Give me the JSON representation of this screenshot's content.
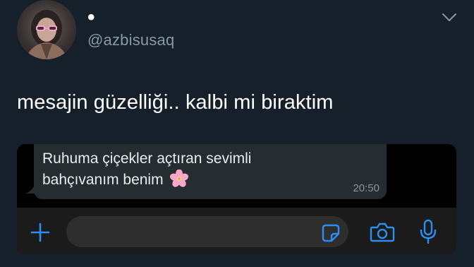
{
  "tweet": {
    "display_name": "•",
    "handle": "@azbisusaq",
    "text": "mesajin güzelliği.. kalbi mi biraktim",
    "menu_icon": "chevron-down-icon"
  },
  "chat": {
    "message": {
      "line1": "Ruhuma çiçekler açtıran sevimli",
      "line2": "bahçıvanım benim",
      "emoji": "cherry-blossom-icon",
      "time": "20:50"
    },
    "input_bar": {
      "icons": [
        "plus-icon",
        "sticker-icon",
        "camera-icon",
        "microphone-icon"
      ],
      "accent": "#2b8ef0"
    }
  },
  "colors": {
    "background": "#15202b",
    "handle": "#8899a6",
    "bubble": "#262d31",
    "accent": "#2b8ef0"
  }
}
